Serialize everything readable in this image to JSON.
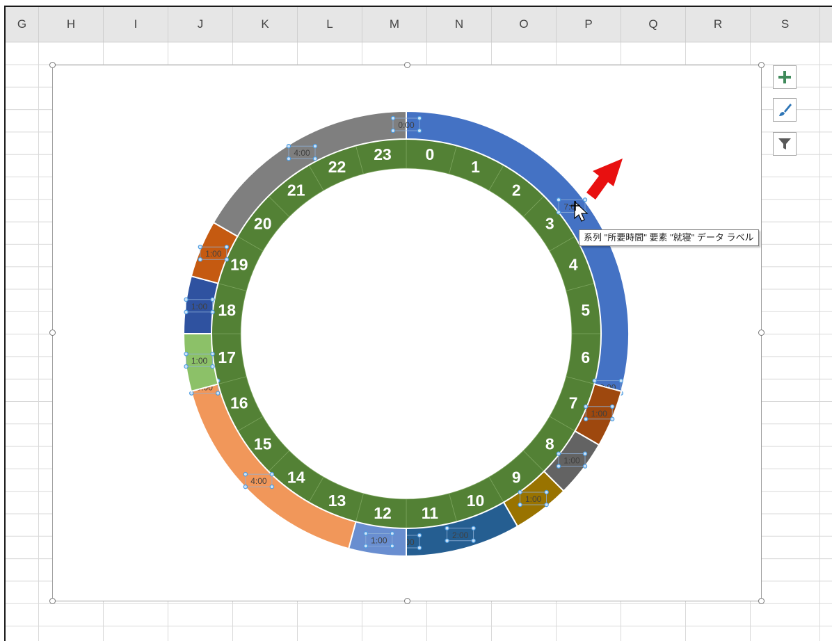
{
  "columns": [
    "G",
    "H",
    "I",
    "J",
    "K",
    "L",
    "M",
    "N",
    "O",
    "P",
    "Q",
    "R",
    "S"
  ],
  "tooltip": "系列 \"所要時間\" 要素 \"就寝\" データ ラベル",
  "toolbar_icons": [
    "plus-icon",
    "brush-icon",
    "filter-icon"
  ],
  "colors": {
    "hour_ring": "#538135",
    "hour_text": "#ffffff",
    "gridline": "#d9d9d9",
    "header_bg": "#e6e6e6",
    "handle": "#4a9be0",
    "arrow": "#e81010"
  },
  "chart_data": [
    {
      "type": "pie",
      "subtype": "doughnut",
      "ring": "inner",
      "series": [
        {
          "name": "",
          "categories": [
            "0",
            "1",
            "2",
            "3",
            "4",
            "5",
            "6",
            "7",
            "8",
            "9",
            "10",
            "11",
            "12",
            "13",
            "14",
            "15",
            "16",
            "17",
            "18",
            "19",
            "20",
            "21",
            "22",
            "23"
          ],
          "values": [
            1,
            1,
            1,
            1,
            1,
            1,
            1,
            1,
            1,
            1,
            1,
            1,
            1,
            1,
            1,
            1,
            1,
            1,
            1,
            1,
            1,
            1,
            1,
            1
          ]
        }
      ],
      "data_labels": "category"
    },
    {
      "type": "pie",
      "subtype": "doughnut",
      "ring": "outer",
      "series": [
        {
          "name": "所要時間",
          "values": [
            7,
            0,
            1,
            1,
            1,
            2,
            0,
            1,
            4,
            0,
            1,
            1,
            1,
            4,
            0
          ],
          "labels": [
            "7:00",
            "0:00",
            "1:00",
            "1:00",
            "1:00",
            "2:00",
            "0:00",
            "1:00",
            "4:00",
            "0:00",
            "1:00",
            "1:00",
            "1:00",
            "4:00",
            "0:00"
          ],
          "colors": [
            "#4472c4",
            "#843c0c",
            "#9e480e",
            "#636363",
            "#997300",
            "#255e91",
            "#264478",
            "#698ed0",
            "#f1975a",
            "#43682b",
            "#8cc168",
            "#2f52a0",
            "#c55a11",
            "#7f7f7f",
            "#264478"
          ]
        }
      ],
      "selected_point": 0
    }
  ]
}
